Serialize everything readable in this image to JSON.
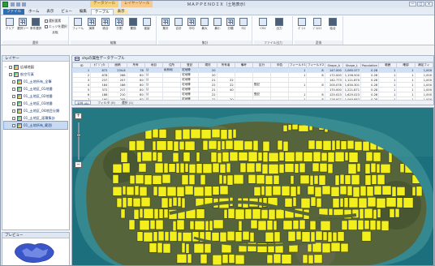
{
  "window": {
    "title": "ＭＡＰＰＥＮＤＩＸ（土地表示）",
    "context_tab_group_1": "データツール",
    "context_tab_group_2": "レイヤーツール",
    "buttons": [
      "—",
      "□",
      "✕"
    ]
  },
  "ribbon": {
    "tabs": [
      {
        "label": "ファイル",
        "kind": "file"
      },
      {
        "label": "ホーム",
        "kind": "normal"
      },
      {
        "label": "表示",
        "kind": "normal"
      },
      {
        "label": "ビュー",
        "kind": "normal"
      },
      {
        "label": "編集",
        "kind": "normal"
      },
      {
        "label": "テーブル",
        "kind": "active"
      },
      {
        "label": "表示",
        "kind": "ctx"
      }
    ],
    "group1": {
      "label": "選択",
      "buttons": [
        "クリア",
        "選択ツール",
        "条件選択",
        "反転"
      ]
    },
    "group1_options": [
      "選択要素",
      "エッジを選択"
    ],
    "group2": {
      "label": "編集",
      "buttons": [
        "フィールド",
        "演算",
        "統合",
        "分割",
        "置換",
        "複製"
      ]
    },
    "group3": {
      "label": "集計",
      "buttons": [
        "集計",
        "合計",
        "平均",
        "最大",
        "最小",
        "分類",
        "ｸﾛｽ"
      ]
    },
    "group4": {
      "label": "ファイル出力",
      "buttons": [
        "CSV",
        "出力"
      ]
    },
    "group5": {
      "label": "変換",
      "buttons": [
        "ﾎﾟｲﾝﾄ",
        "ｼﾞｵﾒﾄﾘ",
        "結合"
      ]
    }
  },
  "layers": {
    "header": "レイヤー",
    "items": [
      {
        "label": "広域地図",
        "indent": 0,
        "group": true,
        "selected": false
      },
      {
        "label": "航空写真",
        "indent": 0,
        "group": false,
        "selected": false
      },
      {
        "label": "01_土地所有_全筆",
        "indent": 1,
        "group": false,
        "selected": false
      },
      {
        "label": "01_土地区_01地番",
        "indent": 1,
        "group": false,
        "selected": false
      },
      {
        "label": "01_土地区_02地番",
        "indent": 1,
        "group": false,
        "selected": false
      },
      {
        "label": "01_土地区_03地番",
        "indent": 1,
        "group": false,
        "selected": false
      },
      {
        "label": "01_土地区_04地目分類",
        "indent": 1,
        "group": false,
        "selected": false
      },
      {
        "label": "01_土地区_面積集計",
        "indent": 1,
        "group": false,
        "selected": false
      },
      {
        "label": "01_土地所有_範囲",
        "indent": 1,
        "group": false,
        "selected": true
      }
    ]
  },
  "preview": {
    "header": "プレビュー"
  },
  "attr_table": {
    "title": "shpの属性データテーブル",
    "columns": [
      "ID",
      "ｵﾌﾞｼﾞｪｸﾄ",
      "面積",
      "所有",
      "地目",
      "住所",
      "登記",
      "現況",
      "所有者",
      "備考",
      "区分",
      "申告",
      "フィールド1",
      "フィールド2",
      "Shape_A",
      "Shape_L",
      "Population",
      "範囲",
      "確認",
      "補足フィ"
    ],
    "rows": [
      [
        "1",
        "872",
        "234.8",
        "78",
        "公",
        "私有地",
        "宅地等",
        "20",
        "",
        "",
        "",
        "",
        "1",
        "8",
        "147.000",
        "1,065.377",
        "0.28",
        "1",
        "1",
        "1,000"
      ],
      [
        "2",
        "878",
        "288",
        "80",
        "公",
        "",
        "宅地等",
        "20",
        "",
        "",
        "",
        "",
        "1",
        "8",
        "172.000",
        "1,156.500",
        "0.28",
        "1",
        "1",
        "1,000"
      ],
      [
        "3",
        "237",
        "207",
        "80",
        "公",
        "",
        "宅地等",
        "21",
        "22",
        "",
        "",
        "",
        "",
        "",
        "142.773",
        "1,121.870",
        "0.28",
        "1",
        "1",
        "1,000"
      ],
      [
        "4",
        "184",
        "186",
        "80",
        "公",
        "",
        "宅地等",
        "22",
        "22",
        "",
        "登記",
        "",
        "1",
        "8",
        "200.078",
        "1,630.301",
        "0.28",
        "1",
        "1",
        "1,000"
      ],
      [
        "5",
        "372",
        "217",
        "80",
        "公",
        "",
        "宅地等",
        "21",
        "40",
        "",
        "",
        "",
        "",
        "",
        "170.000",
        "1,221.871",
        "0.28",
        "1",
        "1",
        "1,000"
      ],
      [
        "6",
        "188",
        "210",
        "80",
        "公",
        "",
        "宅地等",
        "22",
        "",
        "",
        "登記",
        "",
        "1",
        "8",
        "125.023",
        "1,625.023",
        "0.28",
        "1",
        "1",
        "1,000"
      ],
      [
        "7",
        "190",
        "208",
        "80",
        "公",
        "",
        "宅地等",
        "22",
        "20",
        "",
        "",
        "",
        "1",
        "8",
        "118.977",
        "1,093.887",
        "0.28",
        "1",
        "1",
        "1,000"
      ],
      [
        "8",
        "200",
        "212",
        "80",
        "公",
        "",
        "宅地等",
        "22",
        "",
        "",
        "",
        "",
        "",
        "8",
        "122.500",
        "1,040.780",
        "0.28",
        "1",
        "1",
        "1,000"
      ]
    ],
    "selected_row": 0,
    "status_tabs": [
      "全件 (8)",
      "フィルタ (0)",
      "選択 (1)"
    ]
  },
  "map": {
    "zoom_level": 0.32,
    "colors": {
      "sea": "#1c6f7c",
      "reef": "#3b8a8e",
      "land": "#55643a",
      "parcels": "#f2ef1c"
    }
  }
}
